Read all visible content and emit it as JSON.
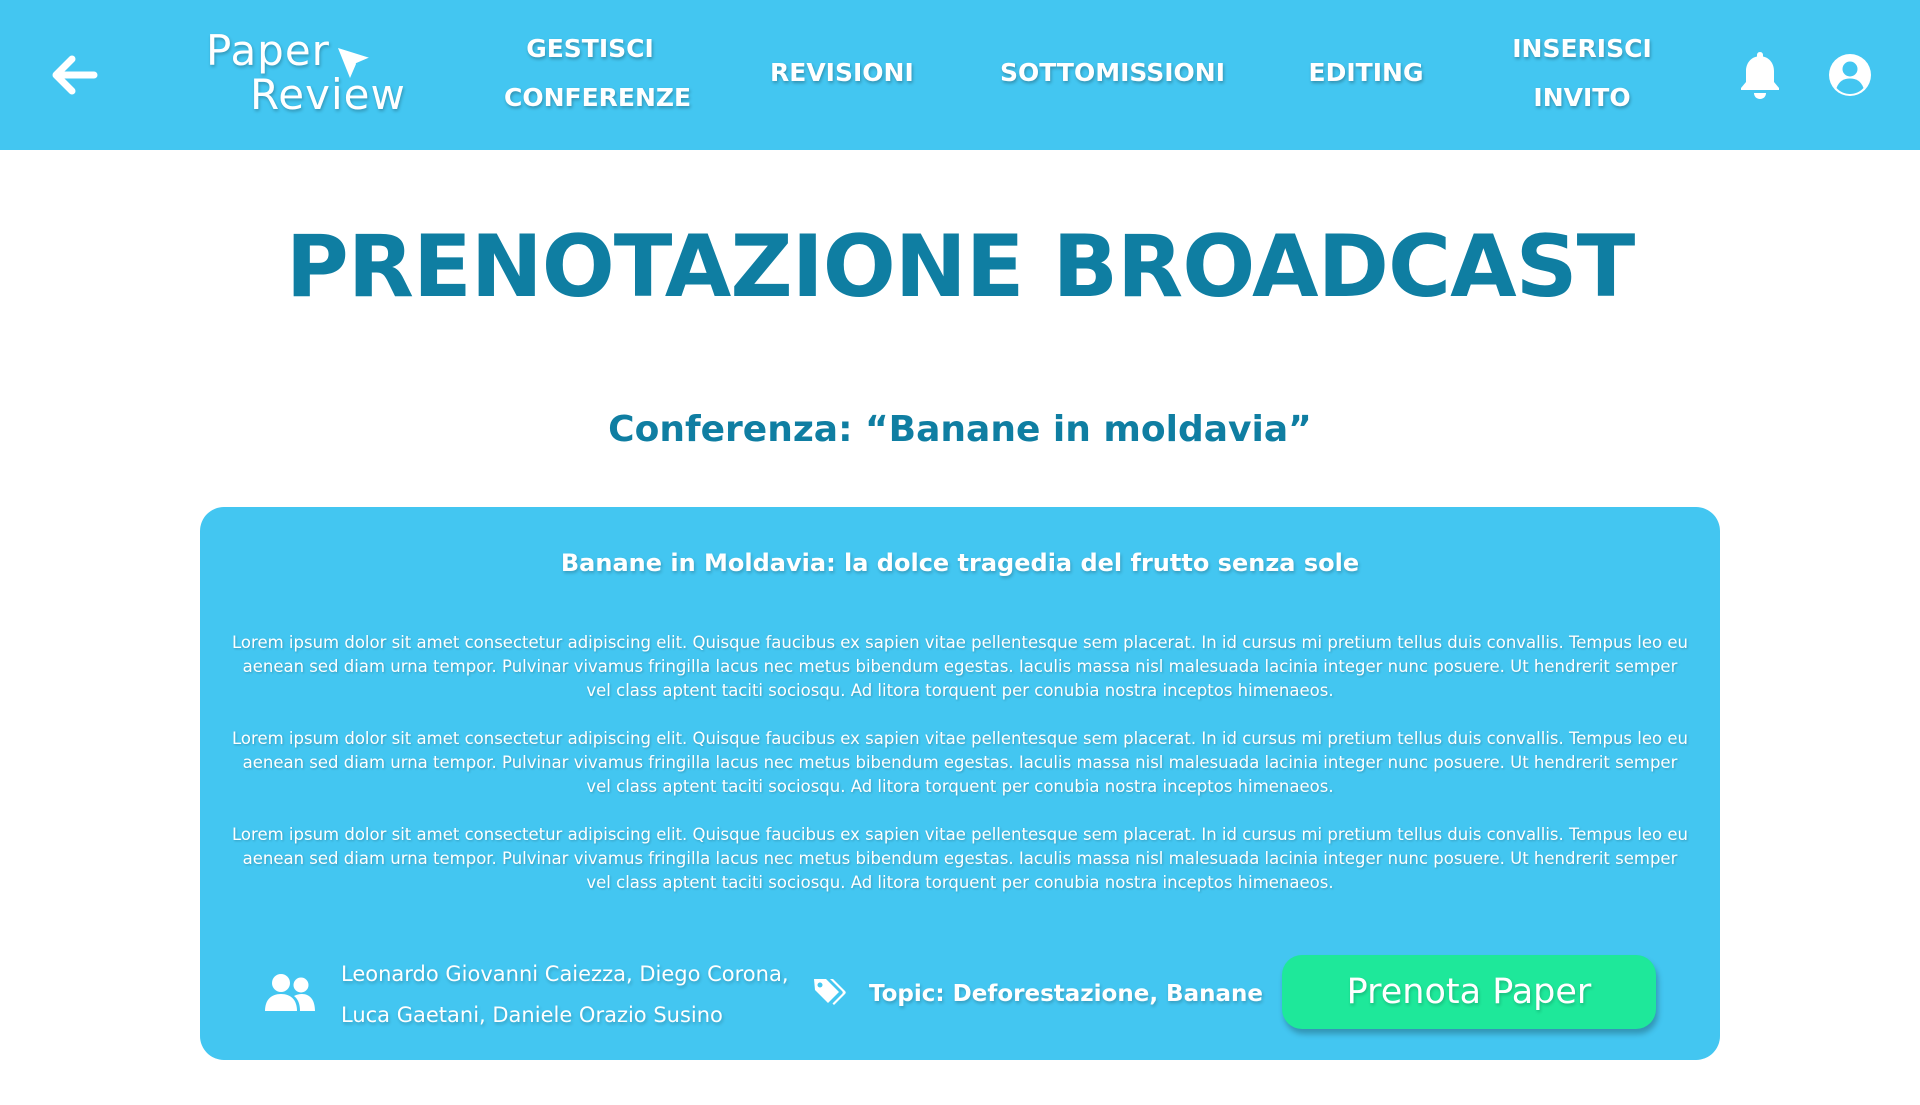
{
  "brand": {
    "line1": "Paper",
    "line2": "Review"
  },
  "nav": {
    "items": [
      {
        "line1": "GESTISCI",
        "line2": "CONFERENZE"
      },
      {
        "line1": "REVISIONI"
      },
      {
        "line1": "SOTTOMISSIONI"
      },
      {
        "line1": "EDITING"
      },
      {
        "line1": "INSERISCI",
        "line2": "INVITO"
      }
    ]
  },
  "page": {
    "title": "PRENOTAZIONE BROADCAST",
    "conference": "Conferenza: “Banane in moldavia”"
  },
  "paper": {
    "title": "Banane in Moldavia: la dolce tragedia del frutto senza sole",
    "abstract": [
      "Lorem ipsum dolor sit amet consectetur adipiscing elit. Quisque faucibus ex sapien vitae pellentesque sem placerat. In id cursus mi pretium tellus duis convallis. Tempus leo eu aenean sed diam urna tempor. Pulvinar vivamus fringilla lacus nec metus bibendum egestas. Iaculis massa nisl malesuada lacinia integer nunc posuere. Ut hendrerit semper vel class aptent taciti sociosqu. Ad litora torquent per conubia nostra inceptos himenaeos.",
      "Lorem ipsum dolor sit amet consectetur adipiscing elit. Quisque faucibus ex sapien vitae pellentesque sem placerat. In id cursus mi pretium tellus duis convallis. Tempus leo eu aenean sed diam urna tempor. Pulvinar vivamus fringilla lacus nec metus bibendum egestas. Iaculis massa nisl malesuada lacinia integer nunc posuere. Ut hendrerit semper vel class aptent taciti sociosqu. Ad litora torquent per conubia nostra inceptos himenaeos.",
      "Lorem ipsum dolor sit amet consectetur adipiscing elit. Quisque faucibus ex sapien vitae pellentesque sem placerat. In id cursus mi pretium tellus duis convallis. Tempus leo eu aenean sed diam urna tempor. Pulvinar vivamus fringilla lacus nec metus bibendum egestas. Iaculis massa nisl malesuada lacinia integer nunc posuere. Ut hendrerit semper vel class aptent taciti sociosqu. Ad litora torquent per conubia nostra inceptos himenaeos."
    ],
    "authors": "Leonardo Giovanni Caiezza, Diego Corona, Luca Gaetani, Daniele Orazio Susino",
    "topics": "Topic: Deforestazione, Banane",
    "book_label": "Prenota Paper"
  },
  "icons": {
    "back": "arrow-left-icon",
    "logo": "paper-plane-icon",
    "notifications": "bell-icon",
    "account": "user-circle-icon",
    "authors": "users-icon",
    "topics": "tags-icon"
  },
  "colors": {
    "primary": "#43c6f1",
    "title": "#0f7ea2",
    "button": "#1ee89a",
    "text_light": "#ffffff"
  }
}
